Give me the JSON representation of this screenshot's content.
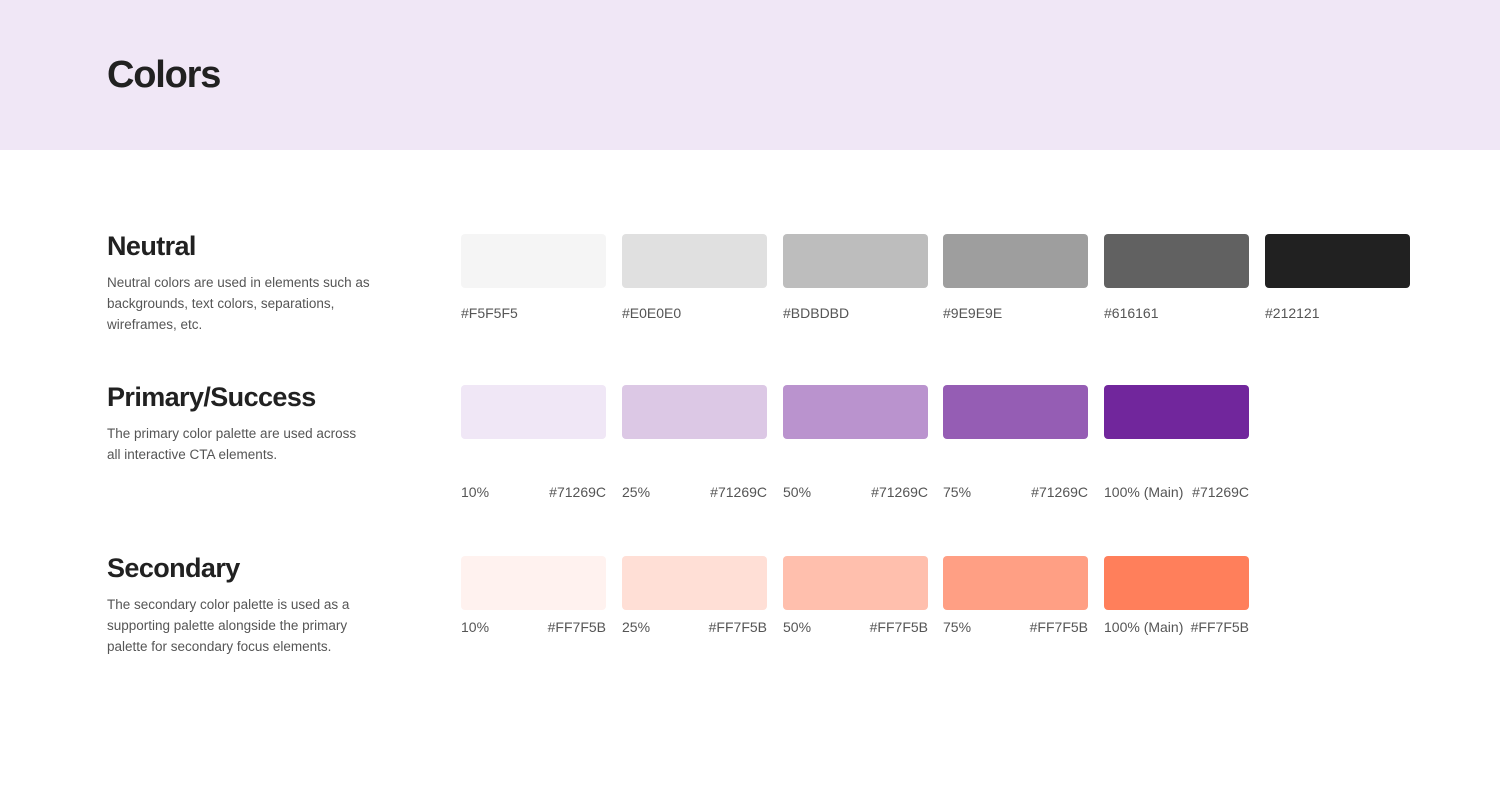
{
  "page": {
    "title": "Colors"
  },
  "sections": {
    "neutral": {
      "title": "Neutral",
      "description": "Neutral colors are used in elements such as backgrounds, text colors, separations, wireframes, etc.",
      "swatches": [
        {
          "hex": "#F5F5F5",
          "color": "#F5F5F5"
        },
        {
          "hex": "#E0E0E0",
          "color": "#E0E0E0"
        },
        {
          "hex": "#BDBDBD",
          "color": "#BDBDBD"
        },
        {
          "hex": "#9E9E9E",
          "color": "#9E9E9E"
        },
        {
          "hex": "#616161",
          "color": "#616161"
        },
        {
          "hex": "#212121",
          "color": "#212121"
        }
      ]
    },
    "primary": {
      "title": "Primary/Success",
      "description": "The primary color palette are used across all interactive CTA elements.",
      "swatches": [
        {
          "percent": "10%",
          "hex": "#71269C",
          "color": "#F0E7F6"
        },
        {
          "percent": "25%",
          "hex": "#71269C",
          "color": "#DCC8E5"
        },
        {
          "percent": "50%",
          "hex": "#71269C",
          "color": "#BA93CE"
        },
        {
          "percent": "75%",
          "hex": "#71269C",
          "color": "#955DB4"
        },
        {
          "percent": "100% (Main)",
          "hex": "#71269C",
          "color": "#71269C"
        }
      ]
    },
    "secondary": {
      "title": "Secondary",
      "description": "The secondary color palette is used as a supporting palette alongside the primary palette for secondary focus elements.",
      "swatches": [
        {
          "percent": "10%",
          "hex": "#FF7F5B",
          "color": "#FFF2EF"
        },
        {
          "percent": "25%",
          "hex": "#FF7F5B",
          "color": "#FFDFD6"
        },
        {
          "percent": "50%",
          "hex": "#FF7F5B",
          "color": "#FFBFAD"
        },
        {
          "percent": "75%",
          "hex": "#FF7F5B",
          "color": "#FF9F84"
        },
        {
          "percent": "100% (Main)",
          "hex": "#FF7F5B",
          "color": "#FF7F5B"
        }
      ]
    }
  }
}
